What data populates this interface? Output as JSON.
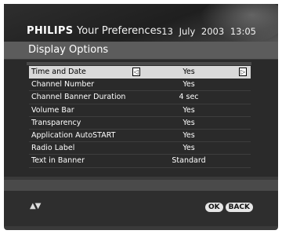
{
  "header": {
    "brand": "PHILIPS",
    "title": "Your Preferences",
    "date": "13 July 2003",
    "time": "13:05"
  },
  "section": {
    "title": "Display Options"
  },
  "rows": [
    {
      "label": "Time and Date",
      "value": "Yes"
    },
    {
      "label": "Channel Number",
      "value": "Yes"
    },
    {
      "label": "Channel Banner Duration",
      "value": "4 sec"
    },
    {
      "label": "Volume Bar",
      "value": "Yes"
    },
    {
      "label": "Transparency",
      "value": "Yes"
    },
    {
      "label": "Application AutoSTART",
      "value": "Yes"
    },
    {
      "label": "Radio Label",
      "value": "Yes"
    },
    {
      "label": "Text in Banner",
      "value": "Standard"
    }
  ],
  "arrows": {
    "left": "◁",
    "right": "▷"
  },
  "footer": {
    "nav": "▲▼",
    "ok": "OK",
    "back": "BACK"
  },
  "colors": {
    "selected_row": "#d9d9d9",
    "background": "#3a3a3a"
  },
  "icons": {
    "nav": "up-down-arrows-icon",
    "left": "left-arrow-icon",
    "right": "right-arrow-icon"
  }
}
